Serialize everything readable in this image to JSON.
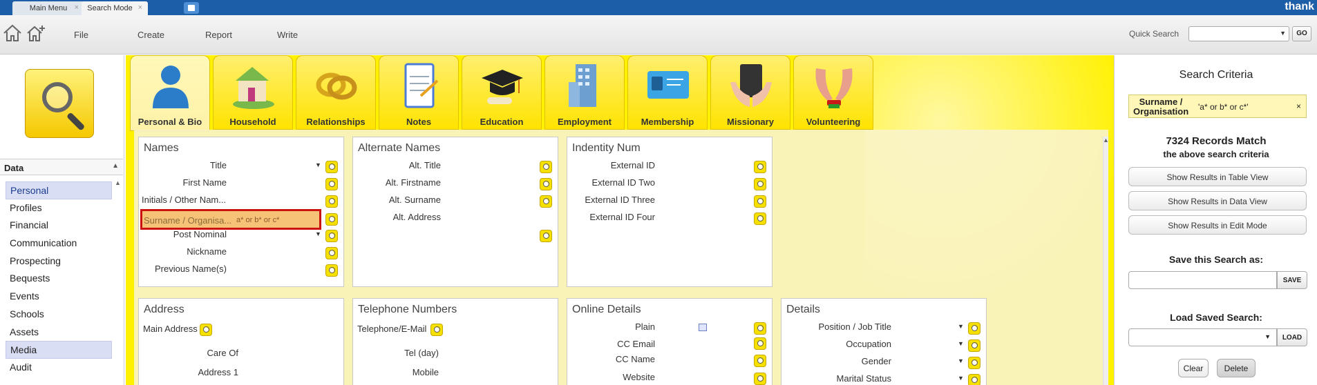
{
  "tabs": {
    "main_menu": "Main Menu",
    "search_mode": "Search Mode",
    "close_glyph": "×"
  },
  "brand": "thank",
  "menu": {
    "file": "File",
    "create": "Create",
    "report": "Report",
    "write": "Write"
  },
  "quick_search": {
    "label": "Quick Search",
    "value": "",
    "go": "GO"
  },
  "leftnav": {
    "header": "Data",
    "items": [
      "Personal",
      "Profiles",
      "Financial",
      "Communication",
      "Prospecting",
      "Bequests",
      "Events",
      "Schools",
      "Assets",
      "Media",
      "Audit"
    ],
    "selected": "Personal",
    "highlighted": "Media"
  },
  "categories": [
    {
      "label": "Personal & Bio",
      "icon": "person-silhouette-icon",
      "color": "#2c7dc9"
    },
    {
      "label": "Household",
      "icon": "family-house-icon",
      "color": "#79b84a"
    },
    {
      "label": "Relationships",
      "icon": "wedding-rings-icon",
      "color": "#d6a51c"
    },
    {
      "label": "Notes",
      "icon": "clipboard-icon",
      "color": "#4b7bd6"
    },
    {
      "label": "Education",
      "icon": "graduation-cap-icon",
      "color": "#222222"
    },
    {
      "label": "Employment",
      "icon": "office-building-icon",
      "color": "#6d9fd1"
    },
    {
      "label": "Membership",
      "icon": "membership-card-icon",
      "color": "#3aa4e4"
    },
    {
      "label": "Missionary",
      "icon": "hands-book-icon",
      "color": "#333333"
    },
    {
      "label": "Volunteering",
      "icon": "raised-hands-icon",
      "color": "#e8a08c"
    }
  ],
  "panels": {
    "names": {
      "title": "Names",
      "fields": [
        "Title",
        "First Name",
        "Initials / Other Nam...",
        "Surname / Organisa...",
        "Post Nominal",
        "Nickname",
        "Previous Name(s)"
      ],
      "highlighted_value": "a* or b* or c*"
    },
    "alternate_names": {
      "title": "Alternate Names",
      "fields": [
        "Alt. Title",
        "Alt. Firstname",
        "Alt. Surname",
        "Alt. Address"
      ]
    },
    "identity_num": {
      "title": "Indentity Num",
      "fields": [
        "External ID",
        "External ID Two",
        "External ID Three",
        "External ID Four"
      ]
    },
    "address": {
      "title": "Address",
      "main_label": "Main Address",
      "fields": [
        "Care Of",
        "Address 1"
      ]
    },
    "telephone": {
      "title": "Telephone Numbers",
      "main_label": "Telephone/E-Mail",
      "fields": [
        "Tel (day)",
        "Mobile"
      ]
    },
    "online": {
      "title": "Online Details",
      "fields": [
        "Plain",
        "CC Email",
        "CC Name",
        "Website"
      ]
    },
    "details": {
      "title": "Details",
      "fields": [
        "Position / Job Title",
        "Occupation",
        "Gender",
        "Marital Status"
      ]
    }
  },
  "right": {
    "title": "Search Criteria",
    "criteria_key": "Surname / Organisation",
    "criteria_value": "'a* or b* or c*'",
    "remove_glyph": "×",
    "match_count": "7324 Records Match",
    "match_sub": "the above search criteria",
    "btn_table": "Show Results in Table View",
    "btn_data": "Show Results in Data View",
    "btn_edit": "Show Results in Edit Mode",
    "save_label": "Save this Search as:",
    "save_btn": "SAVE",
    "load_label": "Load Saved Search:",
    "load_btn": "LOAD",
    "clear": "Clear",
    "delete": "Delete"
  }
}
